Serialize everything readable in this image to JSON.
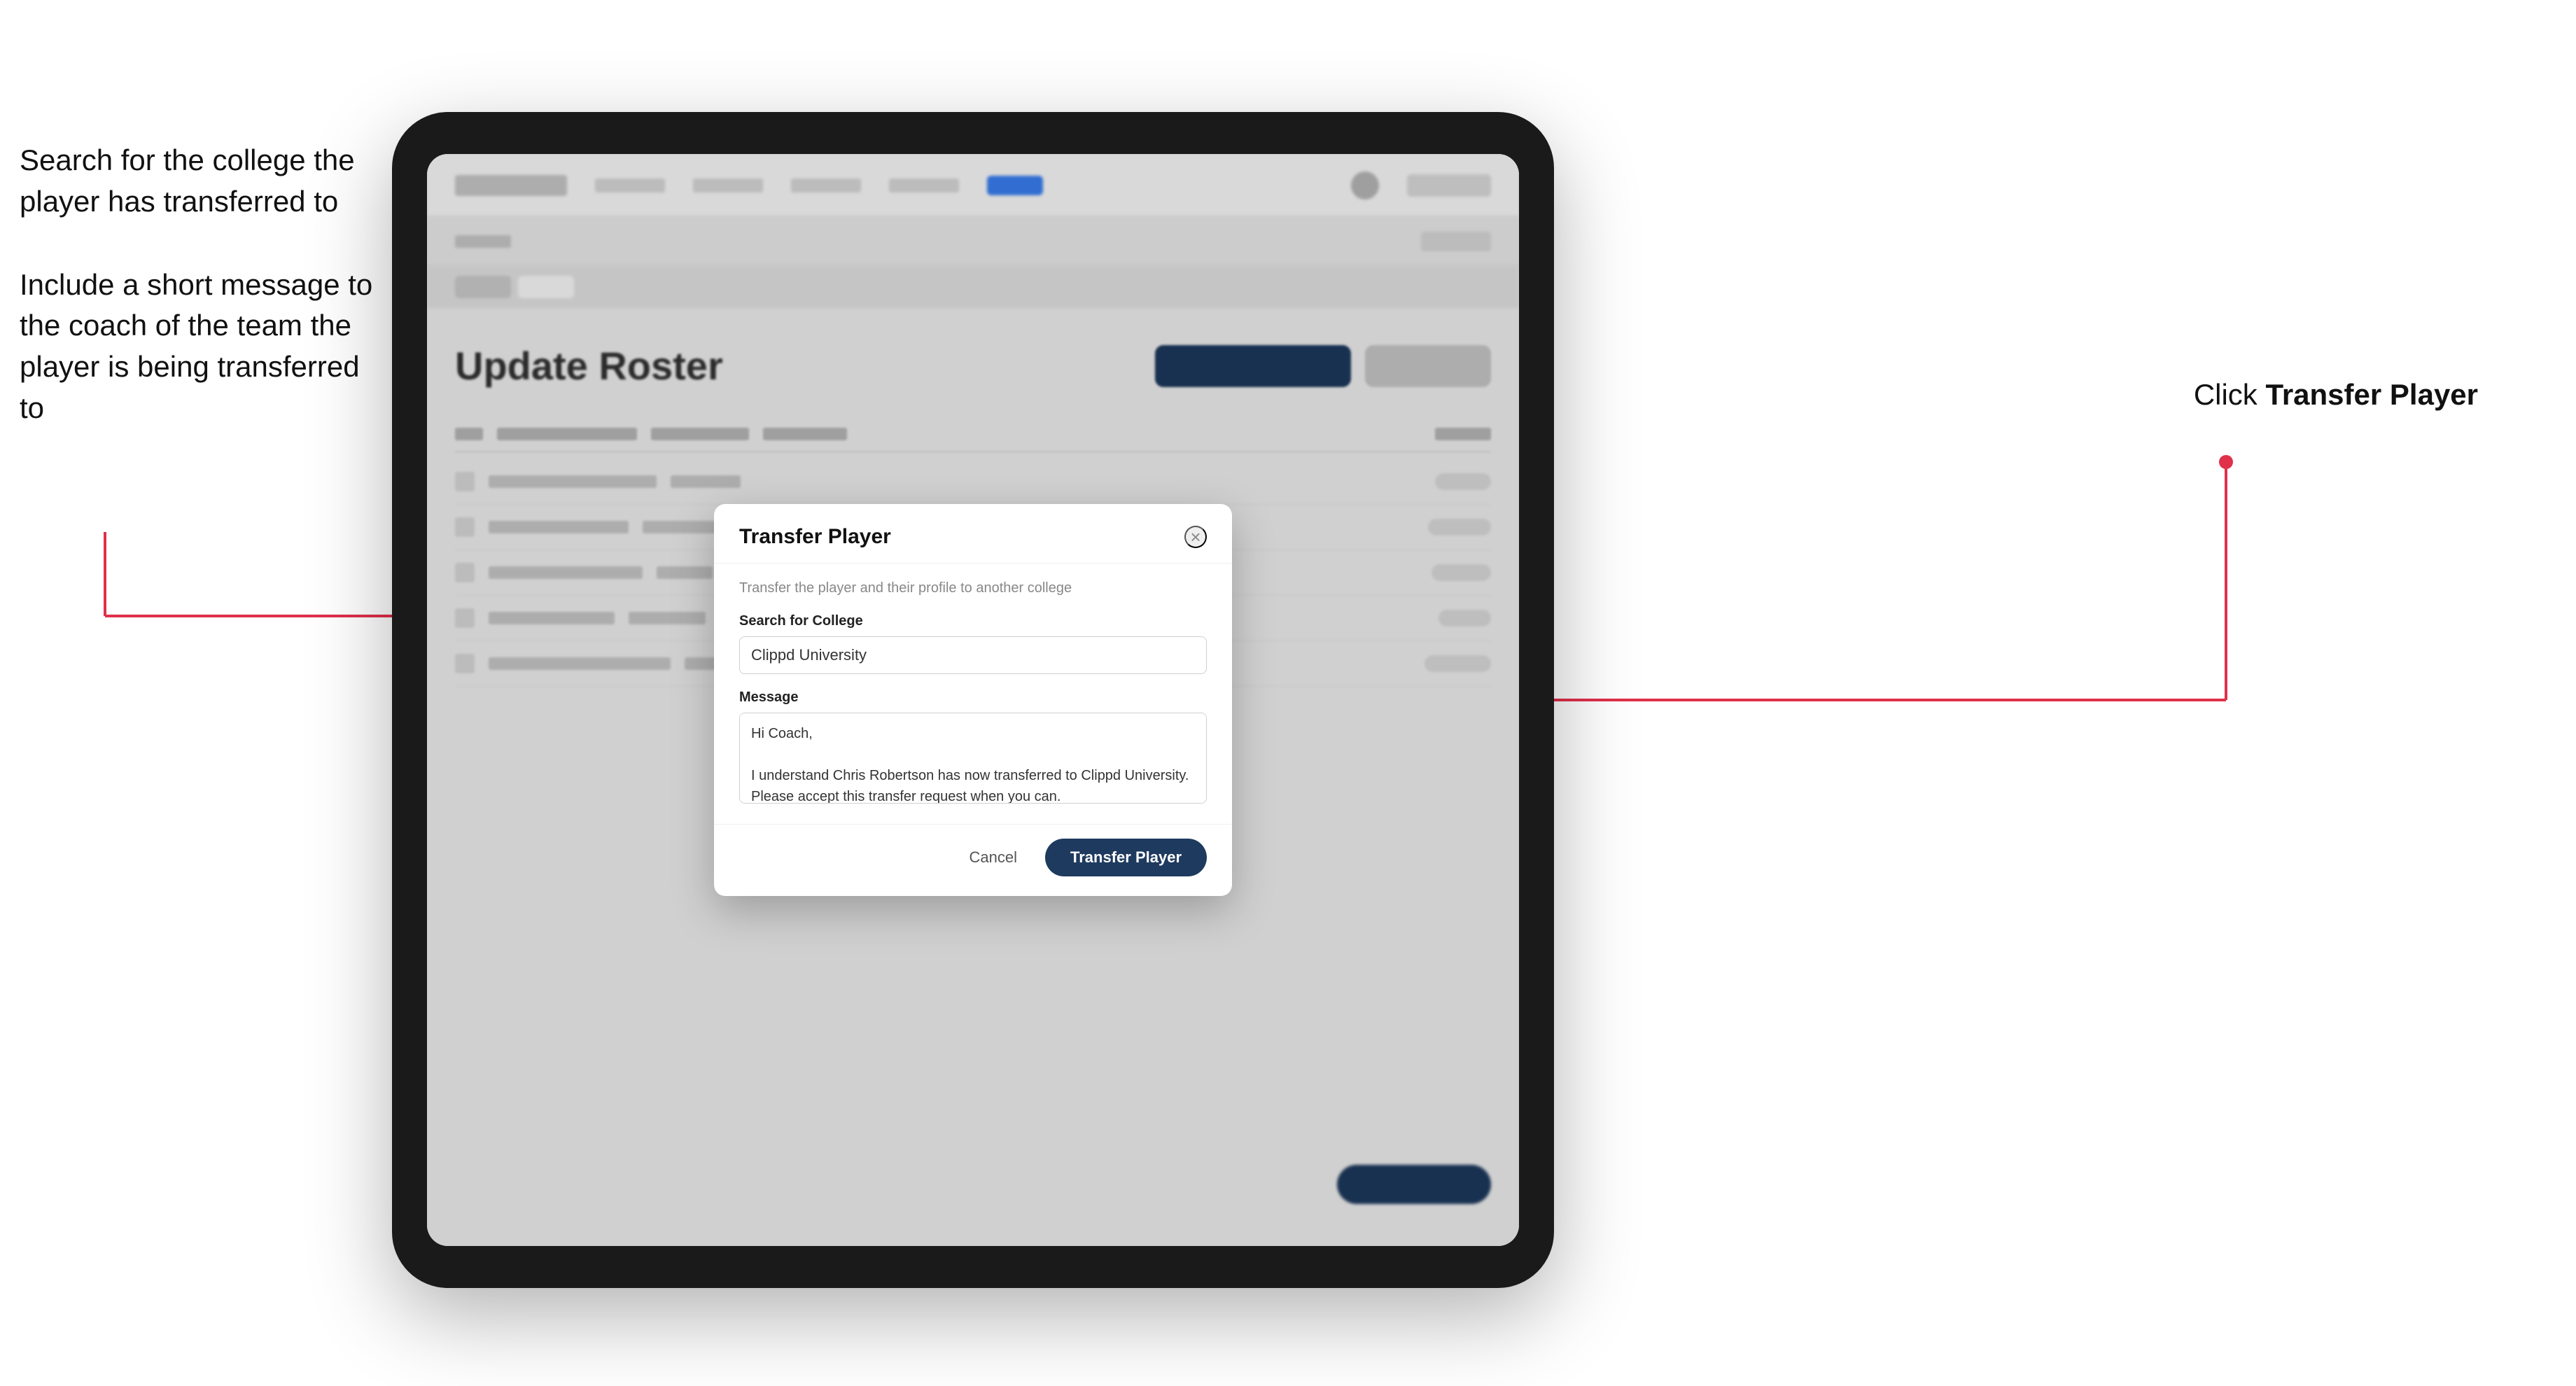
{
  "annotations": {
    "left_text_1": "Search for the college the player has transferred to",
    "left_text_2": "Include a short message to the coach of the team the player is being transferred to",
    "right_text_prefix": "Click ",
    "right_text_bold": "Transfer Player"
  },
  "app": {
    "page_title": "Update Roster"
  },
  "modal": {
    "title": "Transfer Player",
    "subtitle": "Transfer the player and their profile to another college",
    "search_label": "Search for College",
    "search_value": "Clippd University",
    "message_label": "Message",
    "message_value": "Hi Coach,\n\nI understand Chris Robertson has now transferred to Clippd University. Please accept this transfer request when you can.",
    "cancel_label": "Cancel",
    "transfer_label": "Transfer Player",
    "close_icon": "×"
  }
}
